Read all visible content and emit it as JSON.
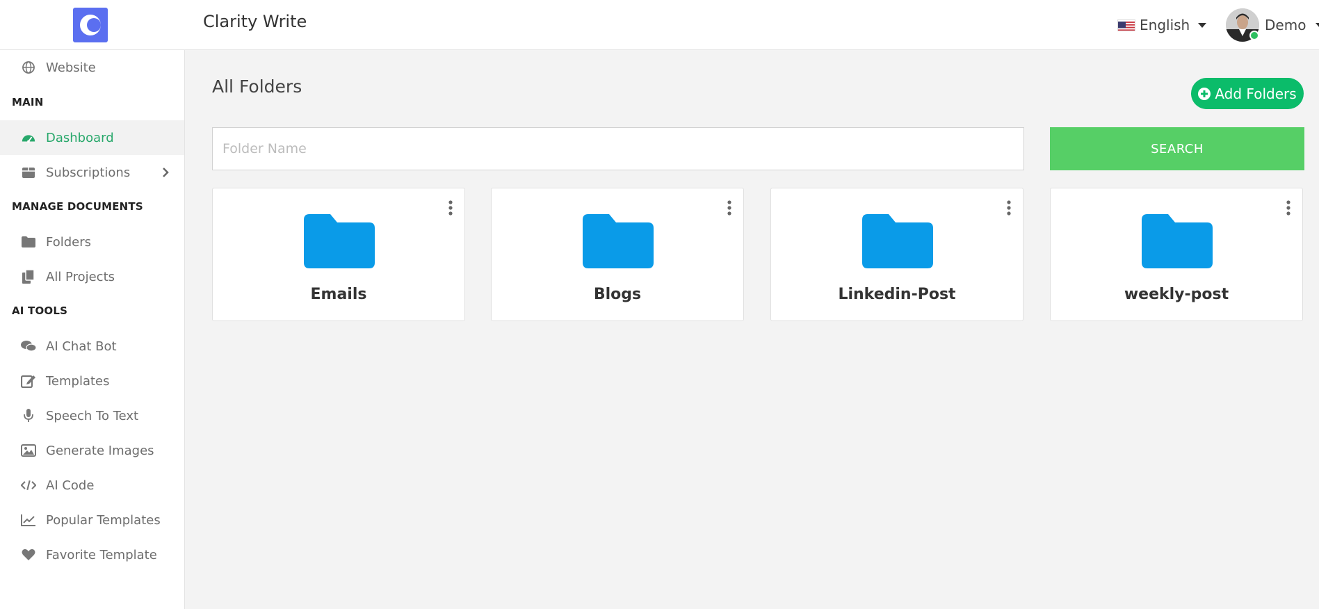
{
  "app": {
    "title": "Clarity Write"
  },
  "header": {
    "language": "English",
    "user_name": "Demo"
  },
  "sidebar": {
    "website": "Website",
    "sections": {
      "main": "MAIN",
      "manage": "MANAGE DOCUMENTS",
      "ai_tools": "AI TOOLS"
    },
    "items": {
      "dashboard": "Dashboard",
      "subscriptions": "Subscriptions",
      "folders": "Folders",
      "all_projects": "All Projects",
      "ai_chat_bot": "AI Chat Bot",
      "templates": "Templates",
      "speech_to_text": "Speech To Text",
      "generate_images": "Generate Images",
      "ai_code": "AI Code",
      "popular_templates": "Popular Templates",
      "favorite_template": "Favorite Template"
    }
  },
  "main": {
    "title": "All Folders",
    "add_button": "Add Folders",
    "search_placeholder": "Folder Name",
    "search_value": "",
    "search_button": "SEARCH",
    "folders": [
      {
        "name": "Emails"
      },
      {
        "name": "Blogs"
      },
      {
        "name": "Linkedin-Post"
      },
      {
        "name": "weekly-post"
      }
    ]
  },
  "colors": {
    "accent_green": "#0bbc6a",
    "search_green": "#56cf66",
    "folder_blue": "#0a9be8",
    "logo_blue": "#5b6ff0"
  }
}
